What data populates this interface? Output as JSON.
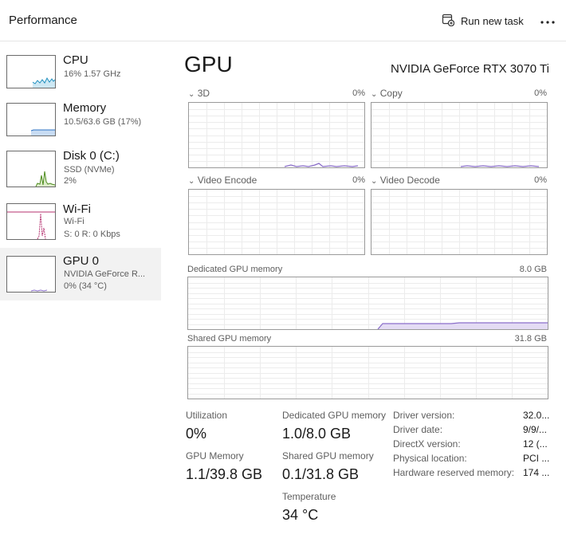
{
  "header": {
    "title": "Performance",
    "run_new_task": "Run new task",
    "more_icon": "more-dots-icon"
  },
  "sidebar": {
    "items": [
      {
        "name": "CPU",
        "line1": "16%  1.57 GHz",
        "line2": ""
      },
      {
        "name": "Memory",
        "line1": "10.5/63.6 GB (17%)",
        "line2": ""
      },
      {
        "name": "Disk 0 (C:)",
        "line1": "SSD (NVMe)",
        "line2": "2%"
      },
      {
        "name": "Wi-Fi",
        "line1": "Wi-Fi",
        "line2": "S: 0  R: 0 Kbps"
      },
      {
        "name": "GPU 0",
        "line1": "NVIDIA GeForce R...",
        "line2": "0%  (34 °C)"
      }
    ],
    "selected": "GPU 0",
    "colors": {
      "cpu": "#1f8fbf",
      "memory": "#2d73c4",
      "disk": "#4e8c1f",
      "wifi": "#b5316f",
      "gpu": "#8a6ec9"
    }
  },
  "main": {
    "title": "GPU",
    "model": "NVIDIA GeForce RTX 3070 Ti",
    "engines": [
      {
        "label": "3D",
        "percent": "0%"
      },
      {
        "label": "Copy",
        "percent": "0%"
      },
      {
        "label": "Video Encode",
        "percent": "0%"
      },
      {
        "label": "Video Decode",
        "percent": "0%"
      }
    ],
    "dedicated": {
      "label": "Dedicated GPU memory",
      "max": "8.0 GB",
      "usage_fraction": 0.13
    },
    "shared": {
      "label": "Shared GPU memory",
      "max": "31.8 GB",
      "usage_fraction": 0.0
    }
  },
  "stats": {
    "utilization": {
      "label": "Utilization",
      "value": "0%"
    },
    "dedicated_mem": {
      "label": "Dedicated GPU memory",
      "value": "1.0/8.0 GB"
    },
    "gpu_memory": {
      "label": "GPU Memory",
      "value": "1.1/39.8 GB"
    },
    "shared_mem": {
      "label": "Shared GPU memory",
      "value": "0.1/31.8 GB"
    },
    "temperature": {
      "label": "Temperature",
      "value": "34 °C"
    }
  },
  "details": [
    {
      "label": "Driver version:",
      "value": "32.0..."
    },
    {
      "label": "Driver date:",
      "value": "9/9/..."
    },
    {
      "label": "DirectX version:",
      "value": "12 (..."
    },
    {
      "label": "Physical location:",
      "value": "PCI ..."
    },
    {
      "label": "Hardware reserved memory:",
      "value": "174 ..."
    }
  ],
  "accent_color": "#8a6ec9"
}
